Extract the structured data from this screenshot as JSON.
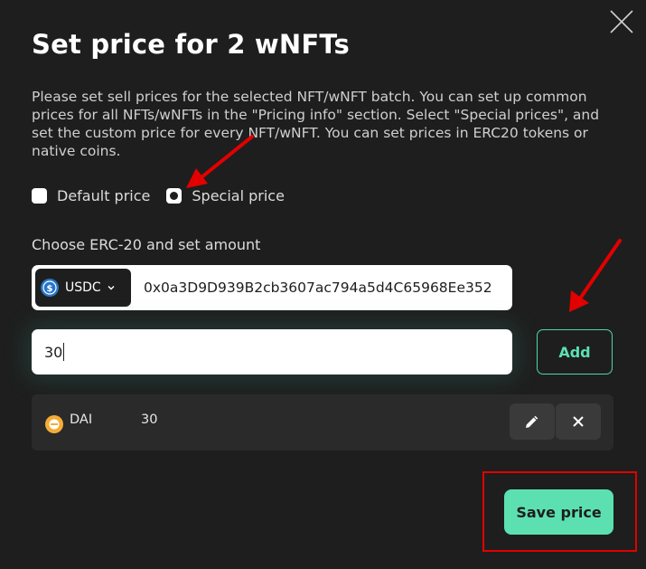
{
  "dialog": {
    "title": "Set price for 2 wNFTs",
    "description": "Please set sell prices for the selected NFT/wNFT batch. You can set up common prices for all NFTs/wNFTs in the \"Pricing info\" section. Select \"Special prices\", and set the custom price for every NFT/wNFT. You can set prices in ERC20 tokens or native coins."
  },
  "price_mode": {
    "options": [
      {
        "label": "Default price",
        "checked": false
      },
      {
        "label": "Special price",
        "checked": true
      }
    ]
  },
  "erc20": {
    "section_label": "Choose ERC-20 and set amount",
    "selected_token": "USDC",
    "token_address": "0x0a3D9D939B2cb3607ac794a5d4C65968Ee352",
    "amount_value": "30",
    "add_label": "Add"
  },
  "prices": [
    {
      "token": "DAI",
      "amount": "30"
    }
  ],
  "actions": {
    "save_label": "Save price"
  },
  "colors": {
    "background": "#1e1e1e",
    "accent": "#5ce0b2",
    "annotation": "#e30000"
  },
  "icons": {
    "close": "close-icon",
    "token_dropdown": "chevron-down-icon",
    "edit": "pencil-icon",
    "remove": "x-icon"
  }
}
